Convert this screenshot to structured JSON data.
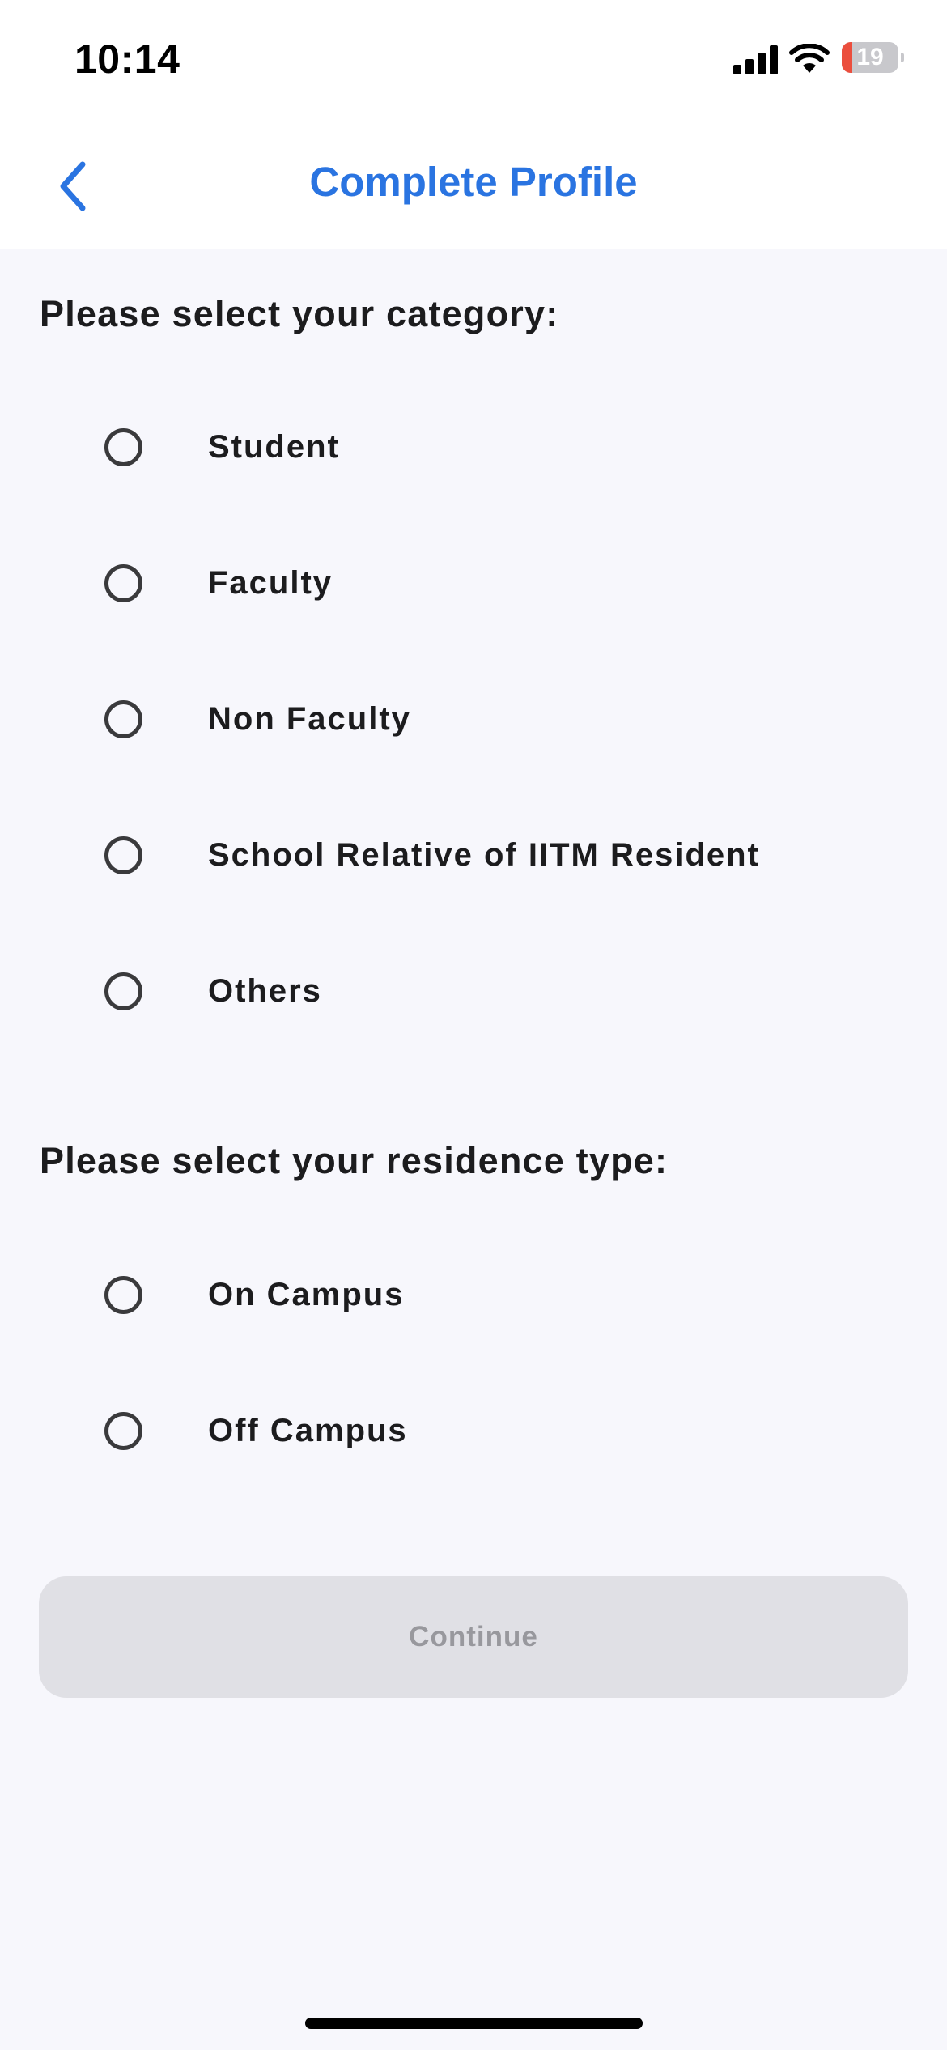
{
  "status_bar": {
    "time": "10:14",
    "battery_level": "19",
    "battery_fraction": 0.19,
    "battery_color": "#eb4e3d",
    "icons": [
      "signal-icon",
      "wifi-icon",
      "battery-icon"
    ]
  },
  "nav": {
    "back_icon": "chevron-left-icon",
    "title": "Complete Profile",
    "accent_color": "#2a74e1"
  },
  "category": {
    "title": "Please select your category:",
    "options": [
      {
        "label": "Student",
        "selected": false
      },
      {
        "label": "Faculty",
        "selected": false
      },
      {
        "label": "Non Faculty",
        "selected": false
      },
      {
        "label": "School Relative of IITM Resident",
        "selected": false
      },
      {
        "label": "Others",
        "selected": false
      }
    ]
  },
  "residence": {
    "title": "Please select your residence type:",
    "options": [
      {
        "label": "On Campus",
        "selected": false
      },
      {
        "label": "Off Campus",
        "selected": false
      }
    ]
  },
  "actions": {
    "continue_label": "Continue",
    "continue_enabled": false
  }
}
